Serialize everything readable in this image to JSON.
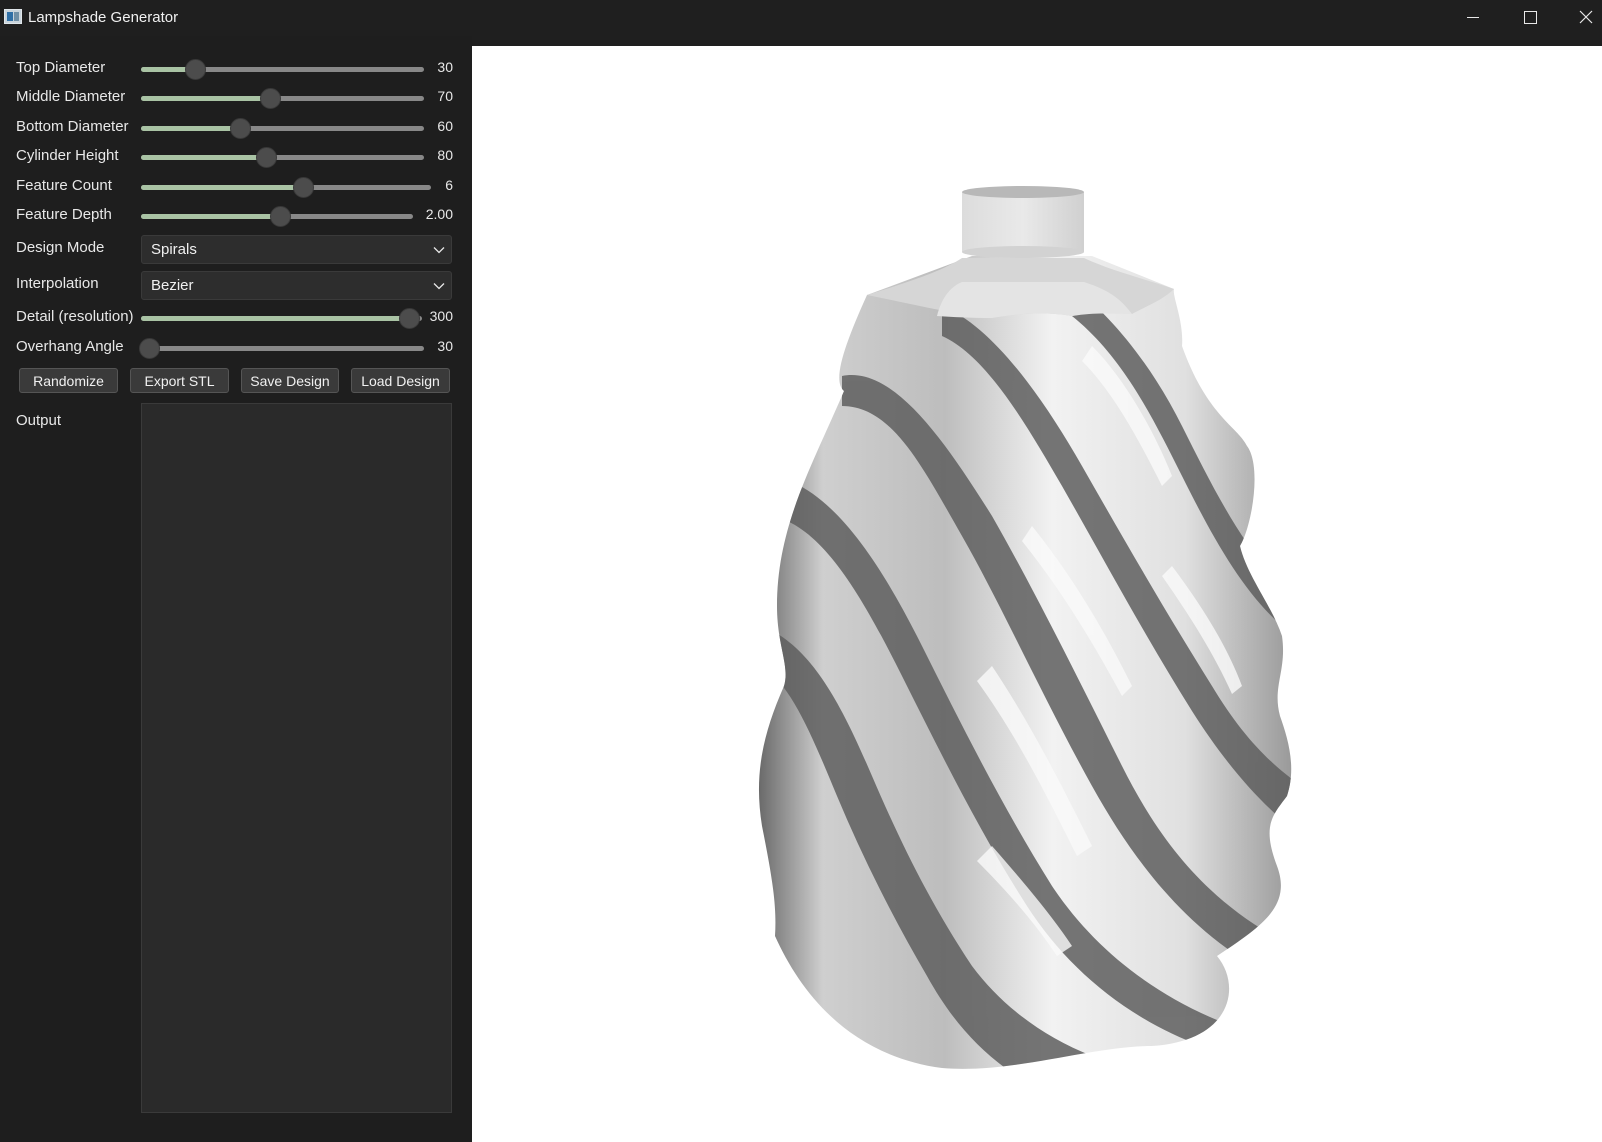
{
  "window": {
    "title": "Lampshade Generator",
    "icons": {
      "app": "app-window-icon",
      "minimize": "minimize-icon",
      "maximize": "maximize-icon",
      "close": "close-icon"
    }
  },
  "sliders": [
    {
      "label": "Top Diameter",
      "value": "30",
      "fraction": 0.19
    },
    {
      "label": "Middle Diameter",
      "value": "70",
      "fraction": 0.455
    },
    {
      "label": "Bottom Diameter",
      "value": "60",
      "fraction": 0.35
    },
    {
      "label": "Cylinder Height",
      "value": "80",
      "fraction": 0.44
    },
    {
      "label": "Feature Count",
      "value": "6",
      "fraction": 0.56
    },
    {
      "label": "Feature Depth",
      "value": "2.00",
      "fraction": 0.51
    }
  ],
  "design_mode": {
    "label": "Design Mode",
    "value": "Spirals"
  },
  "interpolation": {
    "label": "Interpolation",
    "value": "Bezier"
  },
  "sliders2": [
    {
      "label": "Detail (resolution)",
      "value": "300",
      "fraction": 0.955
    },
    {
      "label": "Overhang Angle",
      "value": "30",
      "fraction": 0.03
    }
  ],
  "buttons": {
    "randomize": "Randomize",
    "export_stl": "Export STL",
    "save_design": "Save Design",
    "load_design": "Load Design"
  },
  "output": {
    "label": "Output",
    "text": ""
  },
  "colors": {
    "background": "#1e1e1e",
    "slider_fill": "#a9c3a4",
    "slider_track": "#888888",
    "viewport_bg": "#ffffff",
    "model": "#d9d9d9"
  }
}
